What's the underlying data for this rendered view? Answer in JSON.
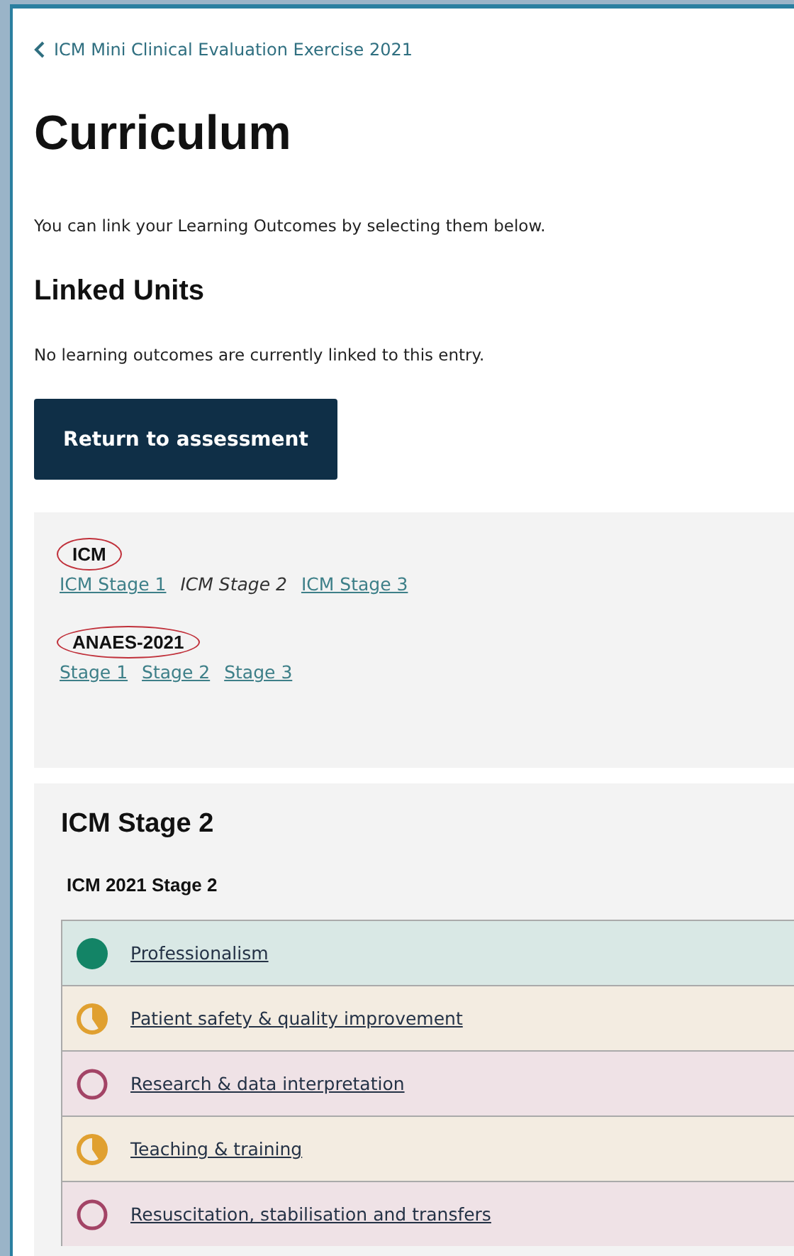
{
  "breadcrumb": "ICM Mini Clinical Evaluation Exercise 2021",
  "title": "Curriculum",
  "intro": "You can link your Learning Outcomes by selecting them below.",
  "linked_units": {
    "heading": "Linked Units",
    "message": "No learning outcomes are currently linked to this entry."
  },
  "return_button": "Return to assessment",
  "curricula": [
    {
      "name": "ICM",
      "circled": true,
      "stages": [
        {
          "label": "ICM Stage 1",
          "selected": false
        },
        {
          "label": "ICM Stage 2",
          "selected": true
        },
        {
          "label": "ICM Stage 3",
          "selected": false
        }
      ]
    },
    {
      "name": "ANAES-2021",
      "circled": true,
      "stages": [
        {
          "label": "Stage 1",
          "selected": false
        },
        {
          "label": "Stage 2",
          "selected": false
        },
        {
          "label": "Stage 3",
          "selected": false
        }
      ]
    }
  ],
  "stage_panel": {
    "heading": "ICM Stage 2",
    "subheading": "ICM 2021 Stage 2",
    "outcomes": [
      {
        "label": "Professionalism",
        "kind": "complete"
      },
      {
        "label": "Patient safety & quality improvement",
        "kind": "partial"
      },
      {
        "label": "Research & data interpretation",
        "kind": "empty"
      },
      {
        "label": "Teaching & training",
        "kind": "partial"
      },
      {
        "label": "Resuscitation, stabilisation and transfers",
        "kind": "empty"
      }
    ]
  }
}
